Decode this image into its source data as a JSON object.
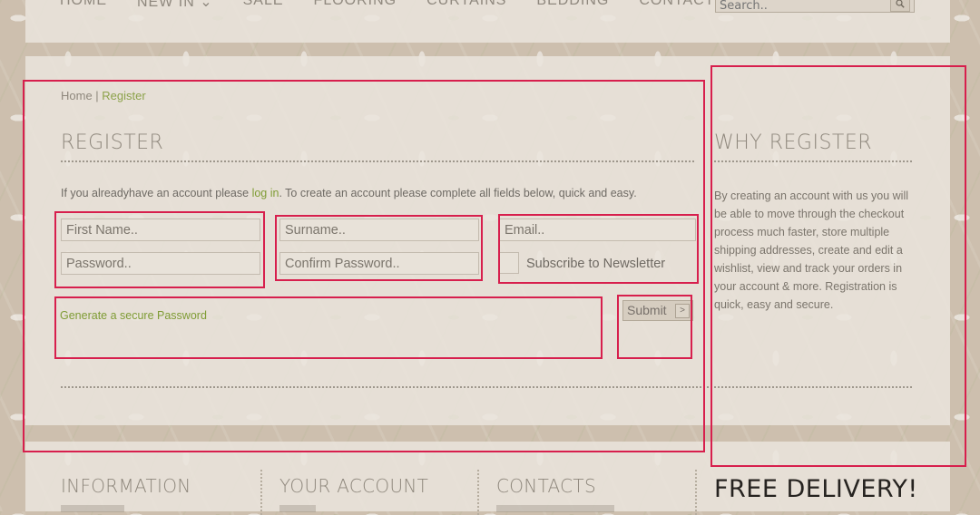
{
  "nav": {
    "items": [
      "HOME",
      "NEW IN ⌄",
      "SALE",
      "FLOORING",
      "CURTAINS",
      "BEDDING",
      "CONTACT US"
    ],
    "search_placeholder": "Search.."
  },
  "breadcrumb": {
    "home": "Home",
    "separator": " | ",
    "current": "Register"
  },
  "register": {
    "heading": "REGISTER",
    "intro_before": "If you alreadyhave an account please ",
    "intro_link": "log in",
    "intro_after": ".  To create an account please complete all fields below, quick and easy.",
    "fields": {
      "first_name": "First Name..",
      "surname": "Surname..",
      "email": "Email..",
      "password": "Password..",
      "confirm_password": "Confirm Password.."
    },
    "subscribe_label": "Subscribe to Newsletter",
    "generate_password": "Generate a secure Password",
    "submit_label": "Submit"
  },
  "why": {
    "heading": "WHY REGISTER",
    "text": "By creating an account with us you will be able to move through the checkout process much faster, store multiple shipping addresses, create and edit a wishlist, view and track your orders in your account & more. Registration is quick, easy and secure."
  },
  "footer": {
    "information": "INFORMATION",
    "your_account": "YOUR ACCOUNT",
    "contacts": "CONTACTS",
    "free_delivery": "FREE DELIVERY!"
  },
  "colors": {
    "accent_green": "#7f9c35",
    "annotation_red": "#d71f4d",
    "panel": "#eae4dc"
  }
}
